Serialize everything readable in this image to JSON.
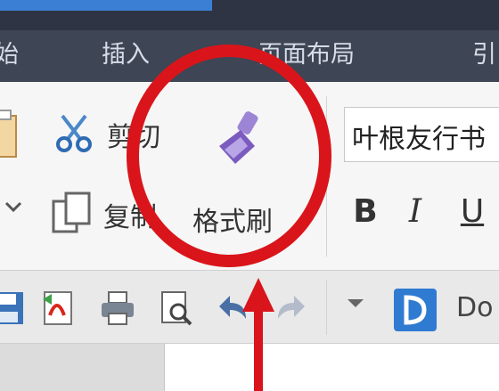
{
  "tabs": [
    {
      "label": "始"
    },
    {
      "label": "插入"
    },
    {
      "label": "页面布局"
    },
    {
      "label": "引"
    }
  ],
  "clipboard": {
    "cut_label": "剪切",
    "copy_label": "复制",
    "format_painter_label": "格式刷"
  },
  "font": {
    "family_value": "叶根友行书",
    "bold_label": "B",
    "italic_label": "I",
    "underline_label": "U"
  },
  "quick_access": {
    "doc_tab_label": "Do"
  },
  "colors": {
    "tabbar_bg": "#3e4554",
    "highlight_red": "#d9151b",
    "format_painter_purple": "#7b5bbf",
    "accent_blue": "#2f7bd1"
  },
  "icons": [
    "paste-icon",
    "scissors-icon",
    "copy-icon",
    "format-painter-icon",
    "save-icon",
    "export-pdf-icon",
    "print-icon",
    "print-preview-icon",
    "undo-icon",
    "redo-icon",
    "dropdown-icon",
    "docer-icon"
  ]
}
